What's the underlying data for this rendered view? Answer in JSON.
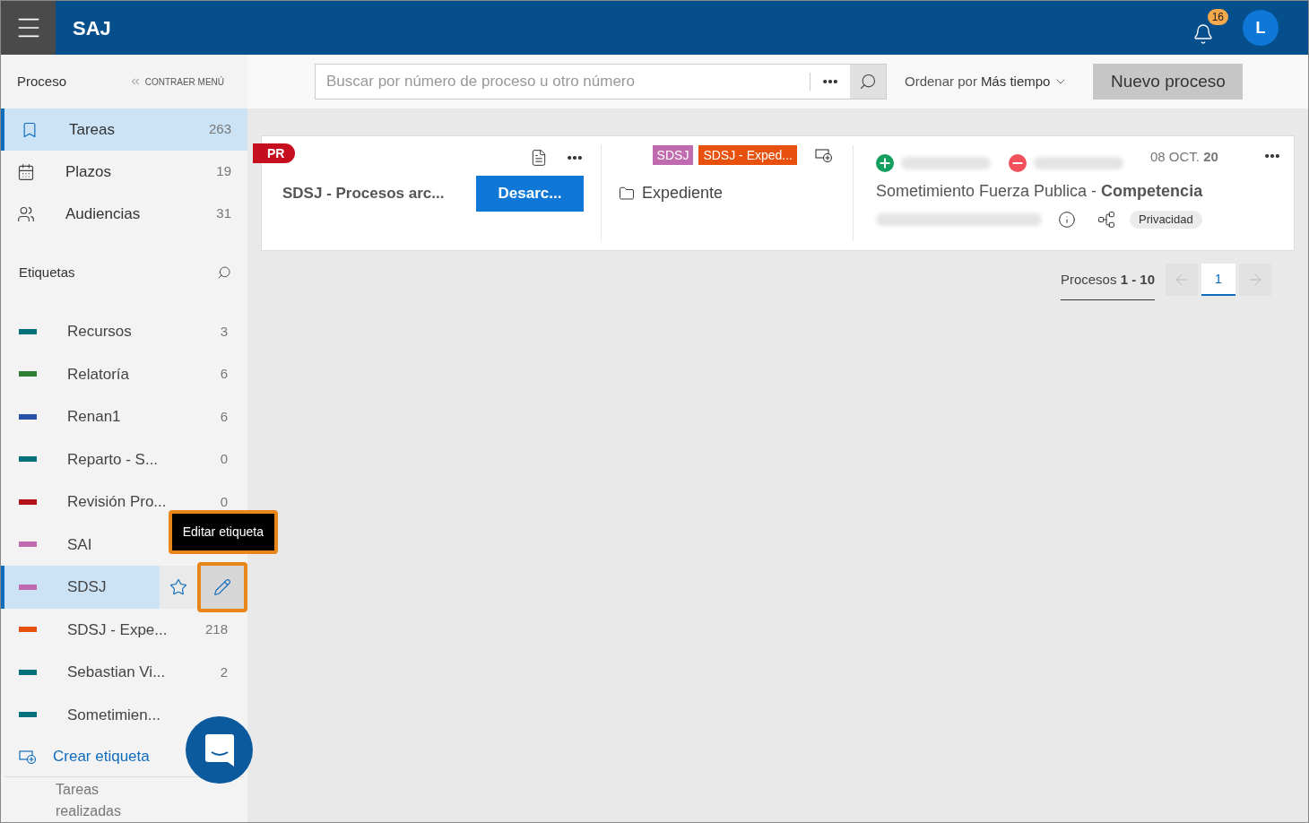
{
  "header": {
    "logo": "SAJ",
    "notifications": "16",
    "avatar": "L"
  },
  "sidebar": {
    "title": "Proceso",
    "collapse": "CONTRAER MENÚ",
    "nav": [
      {
        "kind": "bookmark",
        "label": "Tareas",
        "count": "263",
        "selected": true
      },
      {
        "kind": "calendar",
        "label": "Plazos",
        "count": "19",
        "selected": false
      },
      {
        "kind": "people",
        "label": "Audiencias",
        "count": "31",
        "selected": false
      }
    ],
    "tags_title": "Etiquetas",
    "tags": [
      {
        "name": "Recursos",
        "count": "3",
        "color": "#00707a",
        "selected": false
      },
      {
        "name": "Relatoría",
        "count": "6",
        "color": "#2f7d32",
        "selected": false
      },
      {
        "name": "Renan1",
        "count": "6",
        "color": "#2852a8",
        "selected": false
      },
      {
        "name": "Reparto - S...",
        "count": "0",
        "color": "#00707a",
        "selected": false
      },
      {
        "name": "Revisión Pro...",
        "count": "0",
        "color": "#b5121b",
        "selected": false
      },
      {
        "name": "SAI",
        "color": "#c06bb0",
        "selected": false
      },
      {
        "name": "SDSJ",
        "color": "#c06bb0",
        "selected": true
      },
      {
        "name": "SDSJ - Expe...",
        "count": "218",
        "color": "#e8500e",
        "selected": false
      },
      {
        "name": "Sebastian Vi...",
        "count": "2",
        "color": "#00707a",
        "selected": false
      },
      {
        "name": "Sometimien...",
        "color": "#00707a",
        "selected": false
      }
    ],
    "create": "Crear etiqueta",
    "footer": "Tareas realizadas",
    "tooltip": "Editar etiqueta"
  },
  "toolbar": {
    "search": {
      "placeholder": "Buscar por número de proceso u otro número"
    },
    "sort_label": "Ordenar por",
    "sort_value": "Más tiempo",
    "new_button": "Nuevo proceso"
  },
  "card": {
    "badge": "PR",
    "title": "SDSJ - Procesos arc...",
    "action": "Desarc...",
    "tags": [
      {
        "text": "SDSJ",
        "color": "#c06bb0"
      },
      {
        "text": "SDSJ - Exped...",
        "color": "#e8500e"
      }
    ],
    "folder": "Expediente",
    "date": "08 OCT. **20**",
    "subject": "Sometimiento Fuerza Publica - **Competencia**",
    "chip": "Privacidad"
  },
  "pagination": {
    "label": "Procesos **1 - 10**",
    "pages": [
      {
        "label": "1",
        "selected": true
      }
    ]
  }
}
